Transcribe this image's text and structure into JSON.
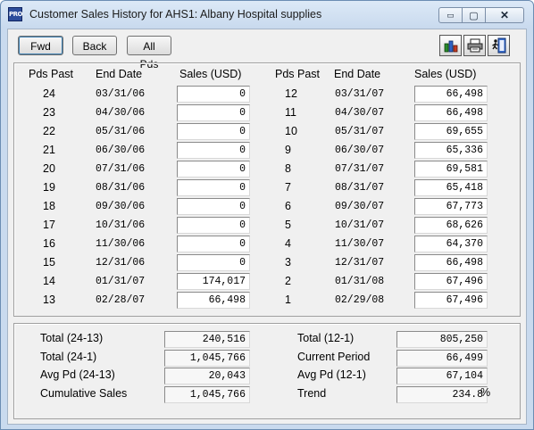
{
  "window": {
    "app_icon": "PRO",
    "title": "Customer Sales History for AHS1: Albany Hospital supplies",
    "caption_min": "▭",
    "caption_max": "▢",
    "caption_close": "✕"
  },
  "toolbar": {
    "fwd": "Fwd",
    "back": "Back",
    "all_pds": "All Pds",
    "icons": [
      "chart-icon",
      "printer-icon",
      "exit-door-icon"
    ]
  },
  "headers": {
    "pds_past": "Pds Past",
    "end_date": "End Date",
    "sales": "Sales (USD)"
  },
  "left_rows": [
    {
      "pds": "24",
      "date": "03/31/06",
      "sales": "0"
    },
    {
      "pds": "23",
      "date": "04/30/06",
      "sales": "0"
    },
    {
      "pds": "22",
      "date": "05/31/06",
      "sales": "0"
    },
    {
      "pds": "21",
      "date": "06/30/06",
      "sales": "0"
    },
    {
      "pds": "20",
      "date": "07/31/06",
      "sales": "0"
    },
    {
      "pds": "19",
      "date": "08/31/06",
      "sales": "0"
    },
    {
      "pds": "18",
      "date": "09/30/06",
      "sales": "0"
    },
    {
      "pds": "17",
      "date": "10/31/06",
      "sales": "0"
    },
    {
      "pds": "16",
      "date": "11/30/06",
      "sales": "0"
    },
    {
      "pds": "15",
      "date": "12/31/06",
      "sales": "0"
    },
    {
      "pds": "14",
      "date": "01/31/07",
      "sales": "174,017"
    },
    {
      "pds": "13",
      "date": "02/28/07",
      "sales": "66,498"
    }
  ],
  "right_rows": [
    {
      "pds": "12",
      "date": "03/31/07",
      "sales": "66,498"
    },
    {
      "pds": "11",
      "date": "04/30/07",
      "sales": "66,498"
    },
    {
      "pds": "10",
      "date": "05/31/07",
      "sales": "69,655"
    },
    {
      "pds": "9",
      "date": "06/30/07",
      "sales": "65,336"
    },
    {
      "pds": "8",
      "date": "07/31/07",
      "sales": "69,581"
    },
    {
      "pds": "7",
      "date": "08/31/07",
      "sales": "65,418"
    },
    {
      "pds": "6",
      "date": "09/30/07",
      "sales": "67,773"
    },
    {
      "pds": "5",
      "date": "10/31/07",
      "sales": "68,626"
    },
    {
      "pds": "4",
      "date": "11/30/07",
      "sales": "64,370"
    },
    {
      "pds": "3",
      "date": "12/31/07",
      "sales": "66,498"
    },
    {
      "pds": "2",
      "date": "01/31/08",
      "sales": "67,496"
    },
    {
      "pds": "1",
      "date": "02/29/08",
      "sales": "67,496"
    }
  ],
  "summary_left": [
    {
      "label": "Total (24-13)",
      "value": "240,516"
    },
    {
      "label": "Total (24-1)",
      "value": "1,045,766"
    },
    {
      "label": "Avg Pd (24-13)",
      "value": "20,043"
    },
    {
      "label": "Cumulative Sales",
      "value": "1,045,766"
    }
  ],
  "summary_right": [
    {
      "label": "Total (12-1)",
      "value": "805,250"
    },
    {
      "label": "Current Period",
      "value": "66,499"
    },
    {
      "label": "Avg Pd (12-1)",
      "value": "67,104"
    },
    {
      "label": "Trend",
      "value": "234.8"
    }
  ],
  "trend_unit": "%"
}
